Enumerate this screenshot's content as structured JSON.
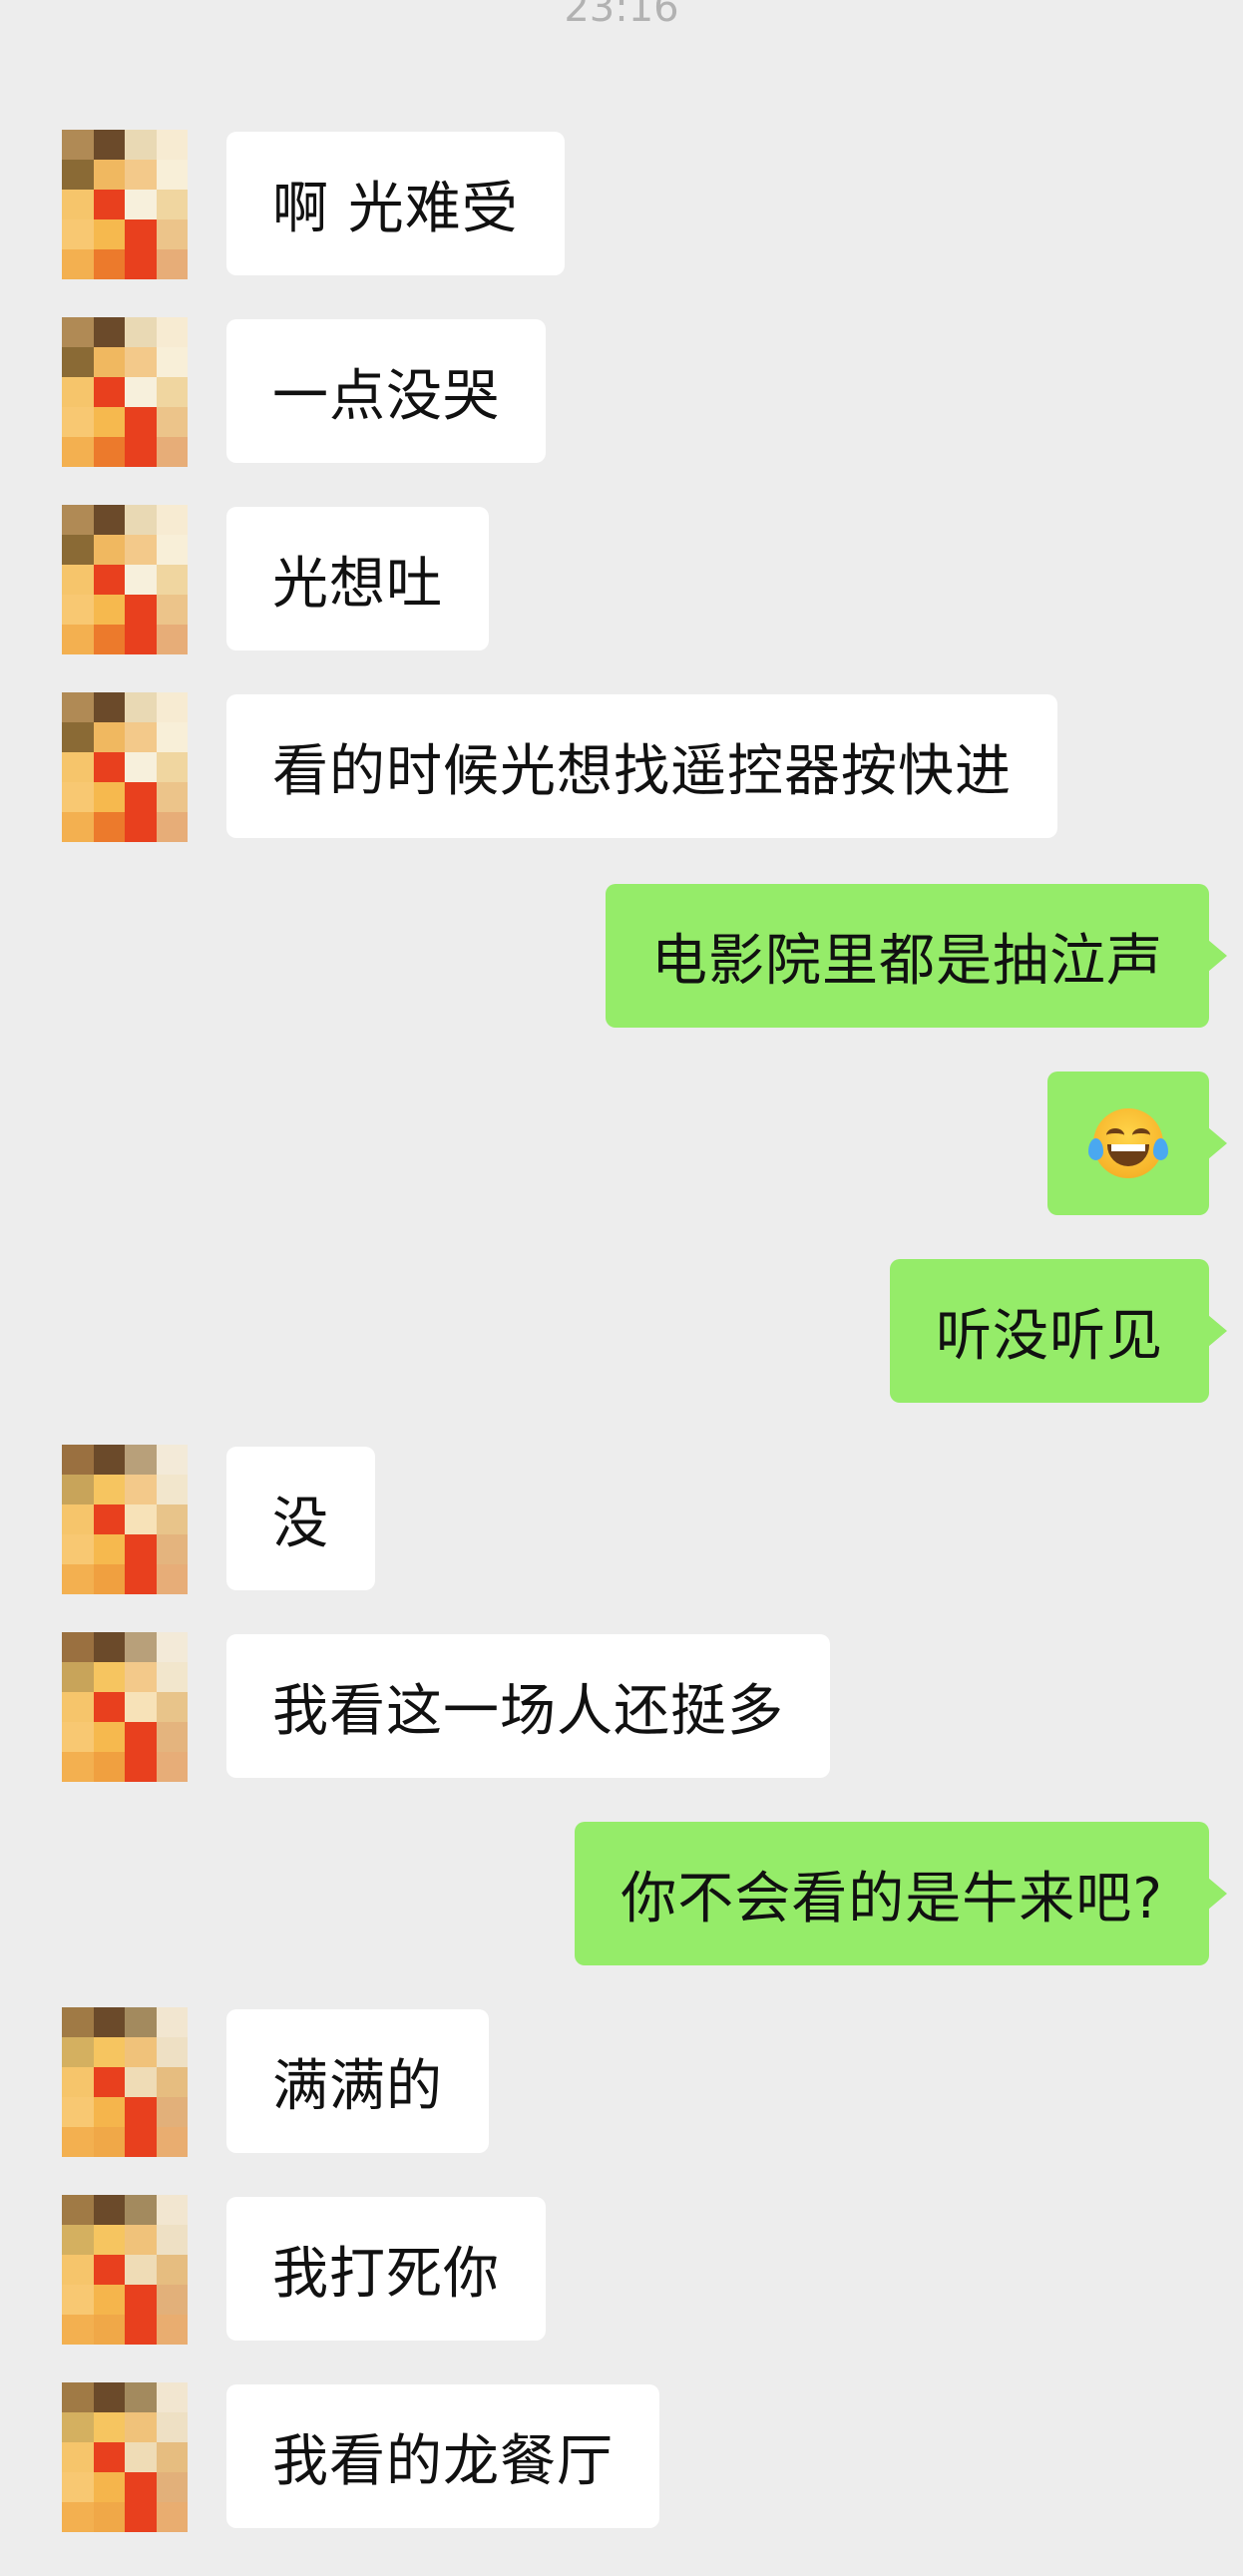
{
  "timestamp": "23:16",
  "colors": {
    "background": "#ededed",
    "incoming_bubble": "#ffffff",
    "outgoing_bubble": "#95ec69",
    "text": "#111111",
    "timestamp": "#b2b2b2"
  },
  "messages": [
    {
      "side": "in",
      "text": "啊 光难受"
    },
    {
      "side": "in",
      "text": "一点没哭"
    },
    {
      "side": "in",
      "text": "光想吐"
    },
    {
      "side": "in",
      "text": "看的时候光想找遥控器按快进"
    },
    {
      "side": "out",
      "text": "电影院里都是抽泣声"
    },
    {
      "side": "out",
      "emoji": "face-with-tears-of-joy-icon"
    },
    {
      "side": "out",
      "text": "听没听见"
    },
    {
      "side": "in",
      "text": "没"
    },
    {
      "side": "in",
      "text": "我看这一场人还挺多"
    },
    {
      "side": "out",
      "text": "你不会看的是牛来吧?"
    },
    {
      "side": "in",
      "text": "满满的"
    },
    {
      "side": "in",
      "text": "我打死你"
    },
    {
      "side": "in",
      "text": "我看的龙餐厅"
    }
  ]
}
